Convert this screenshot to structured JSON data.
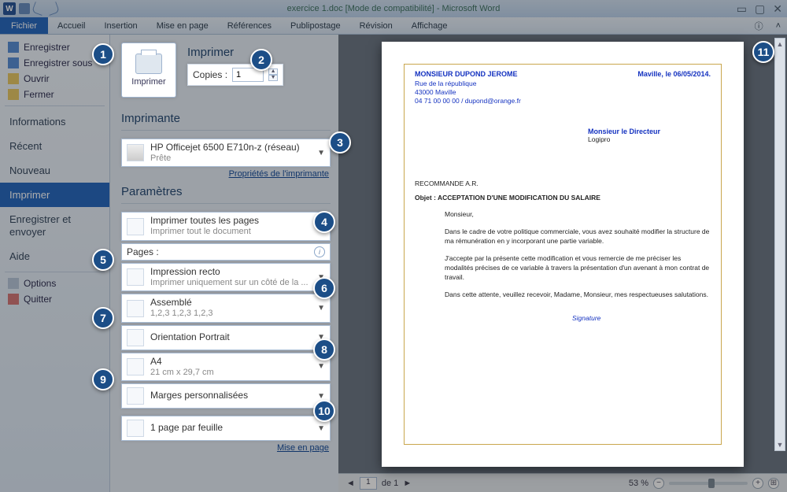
{
  "titlebar": {
    "title": "exercice 1.doc [Mode de compatibilité] - Microsoft Word"
  },
  "ribbon": {
    "file": "Fichier",
    "tabs": [
      "Accueil",
      "Insertion",
      "Mise en page",
      "Références",
      "Publipostage",
      "Révision",
      "Affichage"
    ]
  },
  "sidebar": {
    "quick": [
      {
        "label": "Enregistrer"
      },
      {
        "label": "Enregistrer sous"
      },
      {
        "label": "Ouvrir"
      },
      {
        "label": "Fermer"
      }
    ],
    "sections": [
      {
        "label": "Informations"
      },
      {
        "label": "Récent"
      },
      {
        "label": "Nouveau"
      },
      {
        "label": "Imprimer",
        "active": true
      },
      {
        "label": "Enregistrer et envoyer"
      },
      {
        "label": "Aide"
      }
    ],
    "footer": [
      {
        "label": "Options"
      },
      {
        "label": "Quitter"
      }
    ]
  },
  "print": {
    "heading": "Imprimer",
    "button_label": "Imprimer",
    "copies_label": "Copies :",
    "copies_value": "1",
    "printer_heading": "Imprimante",
    "printer_name": "HP Officejet 6500 E710n-z (réseau)",
    "printer_status": "Prête",
    "printer_props_link": "Propriétés de l'imprimante",
    "settings_heading": "Paramètres",
    "settings": {
      "scope": {
        "label": "Imprimer toutes les pages",
        "sub": "Imprimer tout le document"
      },
      "pages_label": "Pages :",
      "pages_value": "",
      "duplex": {
        "label": "Impression recto",
        "sub": "Imprimer uniquement sur un côté de la ..."
      },
      "collate": {
        "label": "Assemblé",
        "sub": "1,2,3    1,2,3    1,2,3"
      },
      "orientation": {
        "label": "Orientation Portrait"
      },
      "paper": {
        "label": "A4",
        "sub": "21 cm x 29,7 cm"
      },
      "margins": {
        "label": "Marges personnalisées"
      },
      "perpage": {
        "label": "1 page par feuille"
      }
    },
    "page_setup_link": "Mise en page"
  },
  "preview": {
    "nav": {
      "current": "1",
      "of_label": "de 1",
      "prev": "◄",
      "next": "►"
    },
    "zoom": {
      "percent": "53 %",
      "minus": "−",
      "plus": "+"
    }
  },
  "document": {
    "sender_name": "MONSIEUR DUPOND JEROME",
    "sender_addr1": "Rue de la république",
    "sender_addr2": "43000 Maville",
    "sender_contact": "04 71 00 00 00 / dupond@orange.fr",
    "date_place": "Maville, le 06/05/2014.",
    "recipient1": "Monsieur le Directeur",
    "recipient2": "Logipro",
    "mark": "RECOMMANDE A.R.",
    "object": "Objet : ACCEPTATION D'UNE MODIFICATION DU SALAIRE",
    "greeting": "Monsieur,",
    "para1": "Dans le cadre de votre politique commerciale, vous avez souhaité modifier la structure de ma rémunération en y incorporant une partie variable.",
    "para2": "J'accepte par la présente cette modification et vous remercie de me préciser les modalités précises de ce variable à travers la présentation d'un avenant à mon contrat de travail.",
    "para3": "Dans  cette attente, veuillez recevoir, Madame, Monsieur, mes respectueuses salutations.",
    "signature": "Signature"
  },
  "callouts": [
    "1",
    "2",
    "3",
    "4",
    "5",
    "6",
    "7",
    "8",
    "9",
    "10",
    "11"
  ]
}
